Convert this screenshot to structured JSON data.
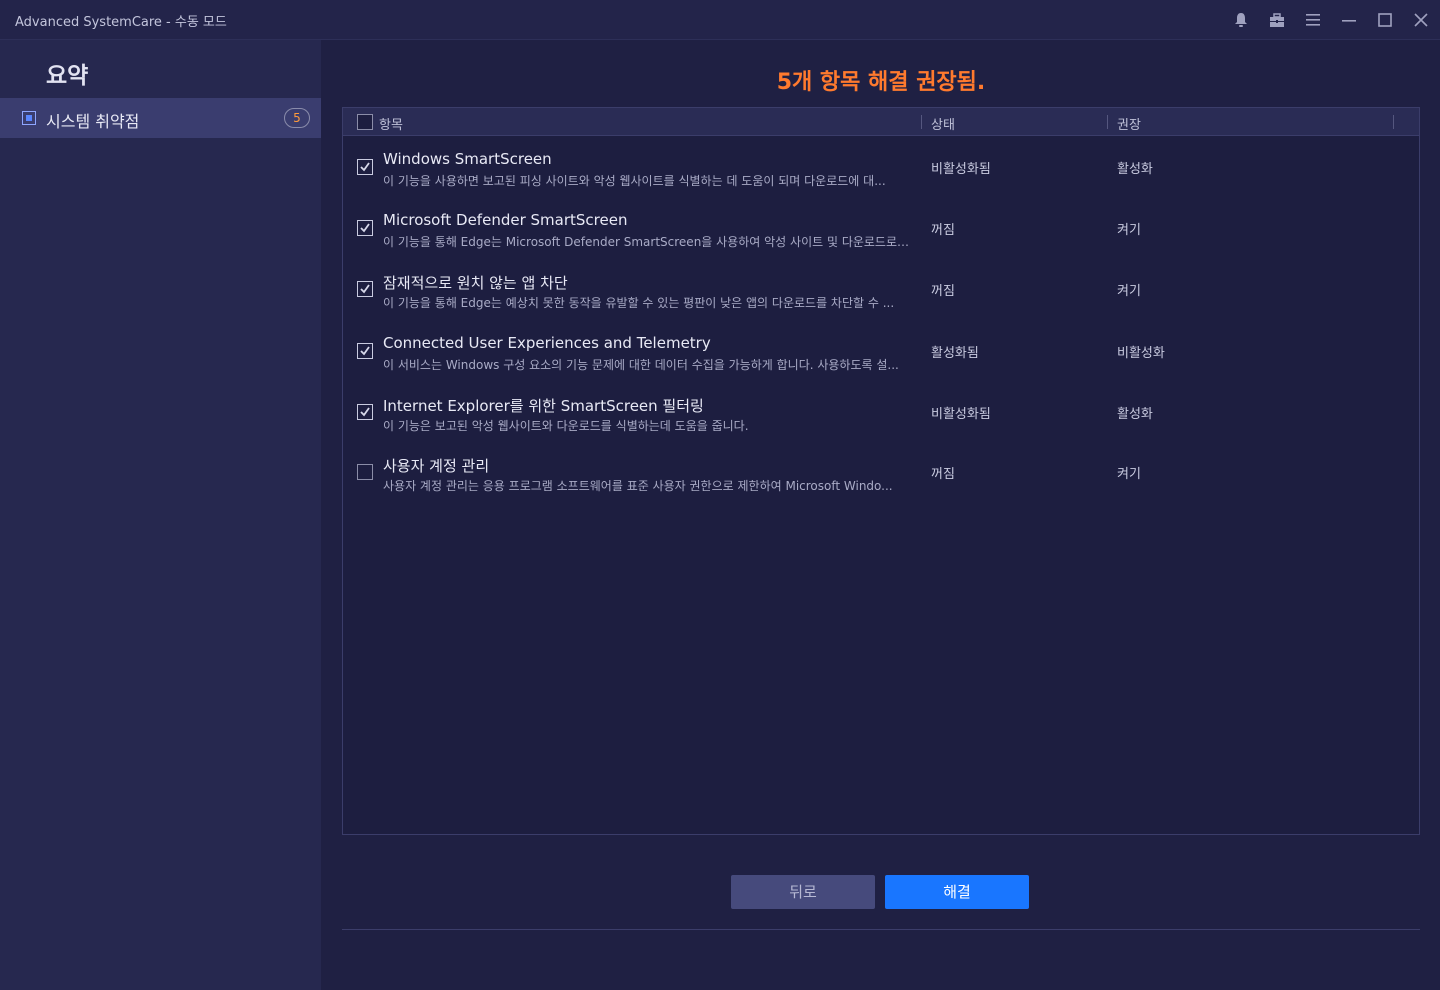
{
  "window": {
    "title": "Advanced SystemCare - 수동 모드"
  },
  "titlebar_icons": [
    "bell-icon",
    "briefcase-icon",
    "menu-icon",
    "minimize-icon",
    "maximize-icon",
    "close-icon"
  ],
  "sidebar": {
    "heading": "요약",
    "items": [
      {
        "label": "시스템 취약점",
        "count": "5",
        "selected": true
      }
    ]
  },
  "main": {
    "headline": "5개 항목 해결 권장됨.",
    "columns": {
      "item": "항목",
      "status": "상태",
      "recommended": "권장"
    },
    "rows": [
      {
        "checked": true,
        "title": "Windows SmartScreen",
        "description": "이 기능을 사용하면 보고된 피싱 사이트와 악성 웹사이트를 식별하는 데 도움이 되며 다운로드에 대...",
        "status": "비활성화됨",
        "recommended": "활성화"
      },
      {
        "checked": true,
        "title": "Microsoft Defender SmartScreen",
        "description": "이 기능을 통해 Edge는 Microsoft Defender SmartScreen을 사용하여 악성 사이트 및 다운로드로부...",
        "status": "꺼짐",
        "recommended": "켜기"
      },
      {
        "checked": true,
        "title": "잠재적으로 원치 않는 앱 차단",
        "description": "이 기능을 통해 Edge는 예상치 못한 동작을 유발할 수 있는 평판이 낮은 앱의 다운로드를 차단할 수 ...",
        "status": "꺼짐",
        "recommended": "켜기"
      },
      {
        "checked": true,
        "title": "Connected User Experiences and Telemetry",
        "description": "이 서비스는 Windows 구성 요소의 기능 문제에 대한 데이터 수집을 가능하게 합니다. 사용하도록 설...",
        "status": "활성화됨",
        "recommended": "비활성화"
      },
      {
        "checked": true,
        "title": "Internet Explorer를 위한 SmartScreen 필터링",
        "description": "이 기능은 보고된 악성 웹사이트와 다운로드를 식별하는데 도움을 줍니다.",
        "status": "비활성화됨",
        "recommended": "활성화"
      },
      {
        "checked": false,
        "title": "사용자 계정 관리",
        "description": "사용자 계정 관리는 응용 프로그램 소프트웨어를 표준 사용자 권한으로 제한하여 Microsoft Windo...",
        "status": "꺼짐",
        "recommended": "켜기"
      }
    ]
  },
  "buttons": {
    "back": "뒤로",
    "fix": "해결"
  },
  "colors": {
    "accent": "#1976ff",
    "headline": "#ff7a2e",
    "background": "#1f2043",
    "sidebar": "#26284f"
  }
}
